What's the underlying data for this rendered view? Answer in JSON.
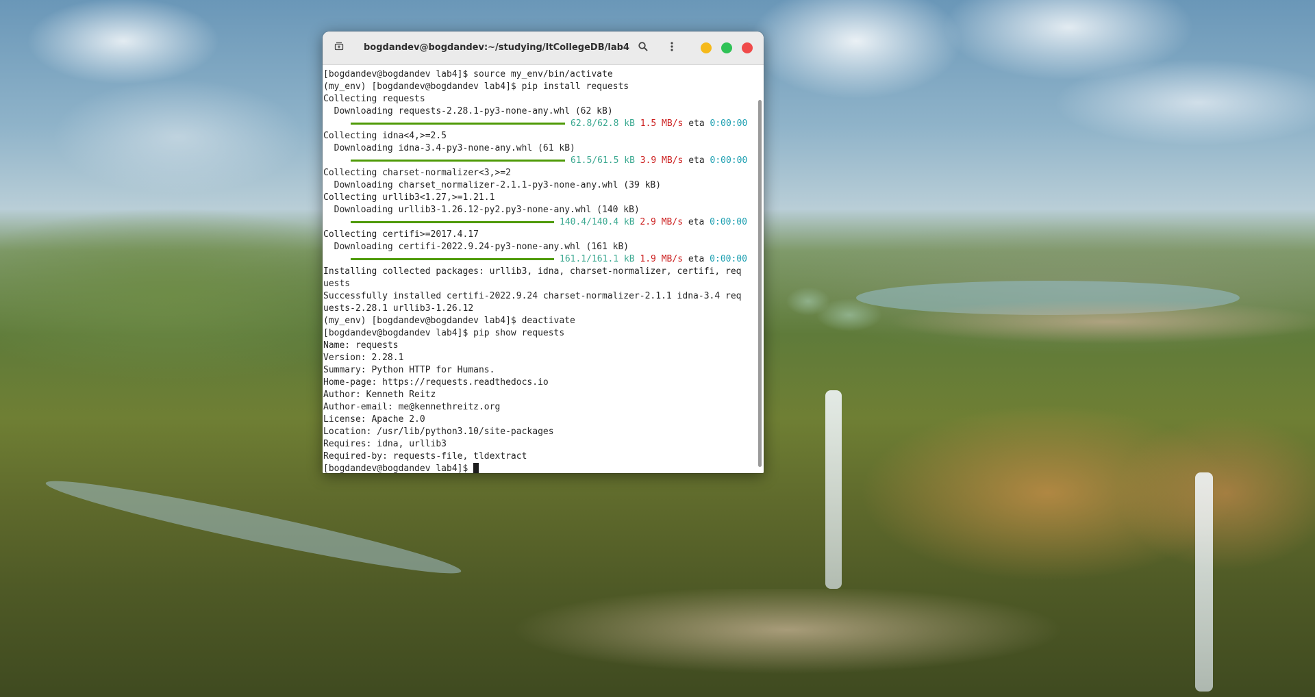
{
  "window": {
    "title": "bogdandev@bogdandev:~/studying/ItCollegeDB/lab4",
    "icons": {
      "new_tab": "new-tab-icon",
      "search": "search-icon",
      "menu": "kebab-menu-icon",
      "minimize": "minimize-icon",
      "maximize": "maximize-icon",
      "close": "close-icon"
    },
    "colors": {
      "minimize": "#f5b91a",
      "maximize": "#2fc256",
      "close": "#f04a4a",
      "progress_bar": "#4e9a06"
    }
  },
  "terminal": {
    "l01": "[bogdandev@bogdandev lab4]$ source my_env/bin/activate",
    "l02": "(my_env) [bogdandev@bogdandev lab4]$ pip install requests",
    "l03": "Collecting requests",
    "l04": "  Downloading requests-2.28.1-py3-none-any.whl (62 kB)",
    "p1": {
      "size": "62.8/62.8 kB",
      "rate": "1.5 MB/s",
      "eta_label": "eta",
      "eta": "0:00:00",
      "progress": 1.0
    },
    "l06": "Collecting idna<4,>=2.5",
    "l07": "  Downloading idna-3.4-py3-none-any.whl (61 kB)",
    "p2": {
      "size": "61.5/61.5 kB",
      "rate": "3.9 MB/s",
      "eta_label": "eta",
      "eta": "0:00:00",
      "progress": 1.0
    },
    "l09": "Collecting charset-normalizer<3,>=2",
    "l10": "  Downloading charset_normalizer-2.1.1-py3-none-any.whl (39 kB)",
    "l11": "Collecting urllib3<1.27,>=1.21.1",
    "l12": "  Downloading urllib3-1.26.12-py2.py3-none-any.whl (140 kB)",
    "p3": {
      "size": "140.4/140.4 kB",
      "rate": "2.9 MB/s",
      "eta_label": "eta",
      "eta": "0:00:00",
      "progress": 1.0
    },
    "l14": "Collecting certifi>=2017.4.17",
    "l15": "  Downloading certifi-2022.9.24-py3-none-any.whl (161 kB)",
    "p4": {
      "size": "161.1/161.1 kB",
      "rate": "1.9 MB/s",
      "eta_label": "eta",
      "eta": "0:00:00",
      "progress": 1.0
    },
    "l17": "Installing collected packages: urllib3, idna, charset-normalizer, certifi, req",
    "l18": "uests",
    "l19": "Successfully installed certifi-2022.9.24 charset-normalizer-2.1.1 idna-3.4 req",
    "l20": "uests-2.28.1 urllib3-1.26.12",
    "l21": "(my_env) [bogdandev@bogdandev lab4]$ deactivate",
    "l22": "[bogdandev@bogdandev lab4]$ pip show requests",
    "l23": "Name: requests",
    "l24": "Version: 2.28.1",
    "l25": "Summary: Python HTTP for Humans.",
    "l26": "Home-page: https://requests.readthedocs.io",
    "l27": "Author: Kenneth Reitz",
    "l28": "Author-email: me@kennethreitz.org",
    "l29": "License: Apache 2.0",
    "l30": "Location: /usr/lib/python3.10/site-packages",
    "l31": "Requires: idna, urllib3",
    "l32": "Required-by: requests-file, tldextract",
    "prompt": "[bogdandev@bogdandev lab4]$ "
  }
}
